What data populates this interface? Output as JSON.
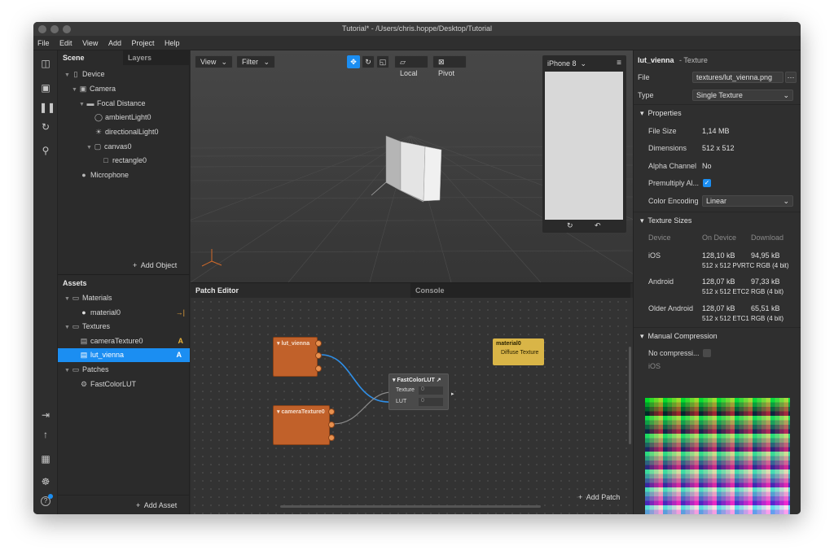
{
  "window": {
    "title": "Tutorial* - /Users/chris.hoppe/Desktop/Tutorial"
  },
  "menu": [
    "File",
    "Edit",
    "View",
    "Add",
    "Project",
    "Help"
  ],
  "scene_panel": {
    "tabs": [
      "Scene",
      "Layers"
    ],
    "items": [
      {
        "label": "Device",
        "icon": "device-icon"
      },
      {
        "label": "Camera",
        "icon": "camera-icon"
      },
      {
        "label": "Focal Distance",
        "icon": "focal-icon"
      },
      {
        "label": "ambientLight0",
        "icon": "ambient-light-icon"
      },
      {
        "label": "directionalLight0",
        "icon": "directional-light-icon"
      },
      {
        "label": "canvas0",
        "icon": "canvas-icon"
      },
      {
        "label": "rectangle0",
        "icon": "rectangle-icon"
      },
      {
        "label": "Microphone",
        "icon": "microphone-icon"
      }
    ],
    "add_label": "Add Object"
  },
  "assets_panel": {
    "title": "Assets",
    "materials_label": "Materials",
    "material_item": "material0",
    "textures_label": "Textures",
    "texture_items": [
      "cameraTexture0",
      "lut_vienna"
    ],
    "patches_label": "Patches",
    "patch_item": "FastColorLUT",
    "badge": "A",
    "add_label": "Add Asset"
  },
  "viewport": {
    "view_label": "View",
    "filter_label": "Filter",
    "local_label": "Local",
    "pivot_label": "Pivot",
    "device": "iPhone 8"
  },
  "patch_editor": {
    "tab_label": "Patch Editor",
    "console_label": "Console",
    "nodes": {
      "lut": "lut_vienna",
      "camera": "cameraTexture0",
      "fast": "FastColorLUT",
      "fast_in1": "Texture",
      "fast_in2": "LUT",
      "fast_val1": "0",
      "fast_val2": "0",
      "material": "material0",
      "material_in": "Diffuse Texture"
    },
    "add_label": "Add Patch"
  },
  "inspector": {
    "name": "lut_vienna",
    "kind": "- Texture",
    "file_label": "File",
    "file_value": "textures/lut_vienna.png",
    "type_label": "Type",
    "type_value": "Single Texture",
    "properties_label": "Properties",
    "file_size_label": "File Size",
    "file_size_value": "1,14 MB",
    "dimensions_label": "Dimensions",
    "dimensions_value": "512 x 512",
    "alpha_label": "Alpha Channel",
    "alpha_value": "No",
    "premultiply_label": "Premultiply Al...",
    "premultiply_checked": true,
    "encoding_label": "Color Encoding",
    "encoding_value": "Linear",
    "sizes_label": "Texture Sizes",
    "sizes_headers": [
      "Device",
      "On Device",
      "Download"
    ],
    "sizes_rows": [
      {
        "device": "iOS",
        "on_device": "128,10 kB",
        "download": "94,95 kB",
        "detail": "512 x 512 PVRTC RGB (4 bit)"
      },
      {
        "device": "Android",
        "on_device": "128,07 kB",
        "download": "97,33 kB",
        "detail": "512 x 512 ETC2 RGB (4 bit)"
      },
      {
        "device": "Older Android",
        "on_device": "128,07 kB",
        "download": "65,51 kB",
        "detail": "512 x 512 ETC1 RGB (4 bit)"
      }
    ],
    "manual_label": "Manual Compression",
    "no_compress_label": "No compressi...",
    "ios_label": "iOS"
  },
  "colors": {
    "accent": "#1b8ef2",
    "patch_orange": "#c1612a",
    "material_yellow": "#d9b547"
  }
}
